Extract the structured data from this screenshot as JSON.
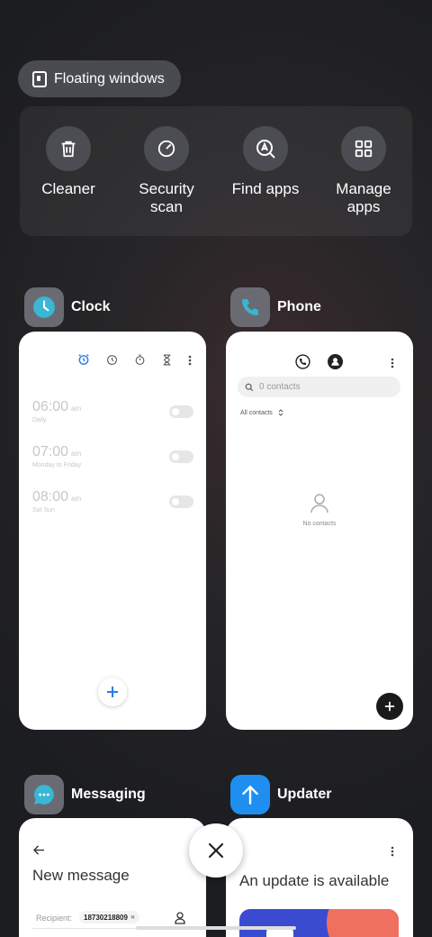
{
  "floating_windows": {
    "label": "Floating windows"
  },
  "tools": [
    {
      "label": "Cleaner",
      "icon": "trash-icon"
    },
    {
      "label": "Security scan",
      "icon": "scan-icon"
    },
    {
      "label": "Find apps",
      "icon": "find-apps-icon"
    },
    {
      "label": "Manage apps",
      "icon": "grid-icon"
    }
  ],
  "apps": {
    "clock": {
      "name": "Clock",
      "alarms": [
        {
          "time": "06:00",
          "ampm": "am",
          "repeat": "Daily"
        },
        {
          "time": "07:00",
          "ampm": "am",
          "repeat": "Monday to Friday"
        },
        {
          "time": "08:00",
          "ampm": "am",
          "repeat": "Sat Sun"
        }
      ]
    },
    "phone": {
      "name": "Phone",
      "search_placeholder": "0 contacts",
      "filter": "All contacts",
      "empty": "No contacts"
    },
    "messaging": {
      "name": "Messaging",
      "title": "New message",
      "recipient_label": "Recipient:",
      "recipient_chip": "18730218809"
    },
    "updater": {
      "name": "Updater",
      "title": "An update is available"
    }
  },
  "colors": {
    "clock_accent": "#3ab6d6",
    "phone_accent": "#38b6d3",
    "updater_icon_bg": "#1e8ff0",
    "blue": "#2c7be5"
  }
}
